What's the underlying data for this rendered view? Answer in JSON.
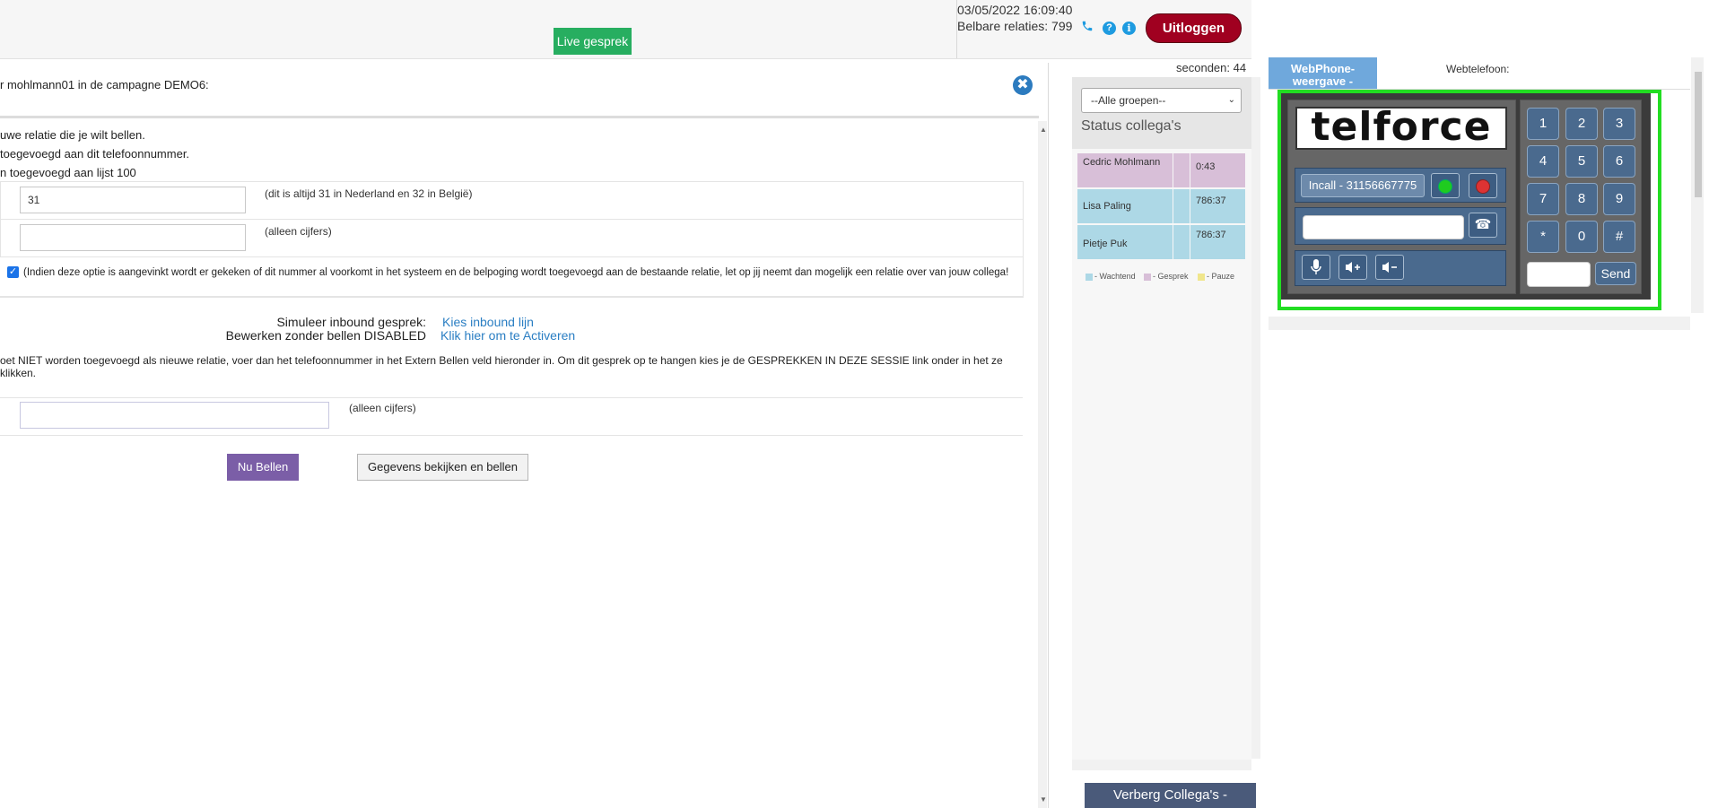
{
  "topbar": {
    "live_label": "Live gesprek",
    "datetime": "03/05/2022 16:09:40",
    "belbare": "Belbare relaties: 799",
    "logout_label": "Uitloggen",
    "phone_icon": "phone-icon",
    "help_icon": "question-circle-icon",
    "help_glyph": "?",
    "info_icon": "info-circle-icon",
    "info_glyph": "i"
  },
  "dialog": {
    "title": "r mohlmann01 in de campagne DEMO6:",
    "close_glyph": "✖",
    "line1": "uwe relatie die je wilt bellen.",
    "line2": "toegevoegd aan dit telefoonnummer.",
    "line3": "n toegevoegd aan lijst 100",
    "country_code_value": "31",
    "country_code_hint": "(dit is altijd 31 in Nederland en 32 in België)",
    "phone_value": "",
    "phone_hint": "(alleen cijfers)",
    "checkbox_checked": true,
    "checkbox_text": "(Indien deze optie is aangevinkt wordt er gekeken of dit nummer al voorkomt in het systeem en de belpoging wordt toegevoegd aan de bestaande relatie, let op jij neemt dan mogelijk een relatie over van jouw collega!",
    "sim_label": "Simuleer inbound gesprek:",
    "sim_link": "Kies inbound lijn",
    "edit_label": "Bewerken zonder bellen DISABLED",
    "edit_link": "Klik hier om te Activeren",
    "note": "oet NIET worden toegevoegd als nieuwe relatie, voer dan het telefoonnummer in het Extern Bellen veld hieronder in. Om dit gesprek op te hangen kies je de GESPREKKEN IN DEZE SESSIE link onder in het ze klikken.",
    "extern_value": "",
    "extern_hint": "(alleen cijfers)",
    "nu_bellen": "Nu Bellen",
    "gegevens": "Gegevens bekijken en bellen"
  },
  "collegas": {
    "seconden": "seconden: 44",
    "group_select": "--Alle groepen--",
    "title": "Status collega's",
    "rows": [
      {
        "name": "Cedric Mohlmann",
        "time": "0:43",
        "status": "gesprek"
      },
      {
        "name": "Lisa Paling",
        "time": "786:37",
        "status": "wachtend"
      },
      {
        "name": "Pietje Puk",
        "time": "786:37",
        "status": "wachtend"
      }
    ],
    "legend": {
      "wachtend": "- Wachtend",
      "gesprek": "- Gesprek",
      "pauze": "- Pauze"
    },
    "toggle_label": "Verberg Collega's -"
  },
  "webphone": {
    "tab_active": "WebPhone-weergave -",
    "tab_label": "Webtelefoon:",
    "logo": "telforce",
    "incall": "Incall - 31156667775",
    "dial_icon": "☎",
    "keypad": [
      "1",
      "2",
      "3",
      "4",
      "5",
      "6",
      "7",
      "8",
      "9",
      "*",
      "0",
      "#"
    ],
    "send_label": "Send",
    "mic_icon": "microphone-icon",
    "vol_up_icon": "volume-up-icon",
    "vol_down_icon": "volume-down-icon"
  },
  "colors": {
    "live_green": "#27ae60",
    "logout_red": "#a00020",
    "link_blue": "#2a7ec3",
    "nu_bellen_purple": "#7b5ea7",
    "wachtend": "#add8e6",
    "gesprek": "#d8bfd8",
    "pauze": "#f0e68c",
    "phone_border": "#22dd22"
  }
}
